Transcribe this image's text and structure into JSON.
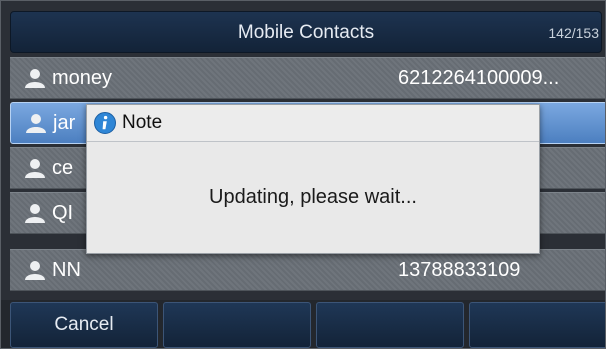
{
  "header": {
    "title": "Mobile Contacts",
    "counter": "142/153"
  },
  "contacts": [
    {
      "name": "money",
      "number": "6212264100009..."
    },
    {
      "name": "jar",
      "number": ""
    },
    {
      "name": "ce",
      "number": ""
    },
    {
      "name": "QI",
      "number": ""
    },
    {
      "name": "NN",
      "number": "13788833109"
    }
  ],
  "dialog": {
    "icon": "info-icon",
    "title": "Note",
    "message": "Updating, please wait..."
  },
  "softkeys": [
    {
      "label": "Cancel"
    },
    {
      "label": ""
    },
    {
      "label": ""
    },
    {
      "label": ""
    }
  ],
  "colors": {
    "titlebar": "#1d3350",
    "selected_row": "#5d8fcf",
    "row": "#6b7178",
    "info_icon": "#2f86d6"
  }
}
